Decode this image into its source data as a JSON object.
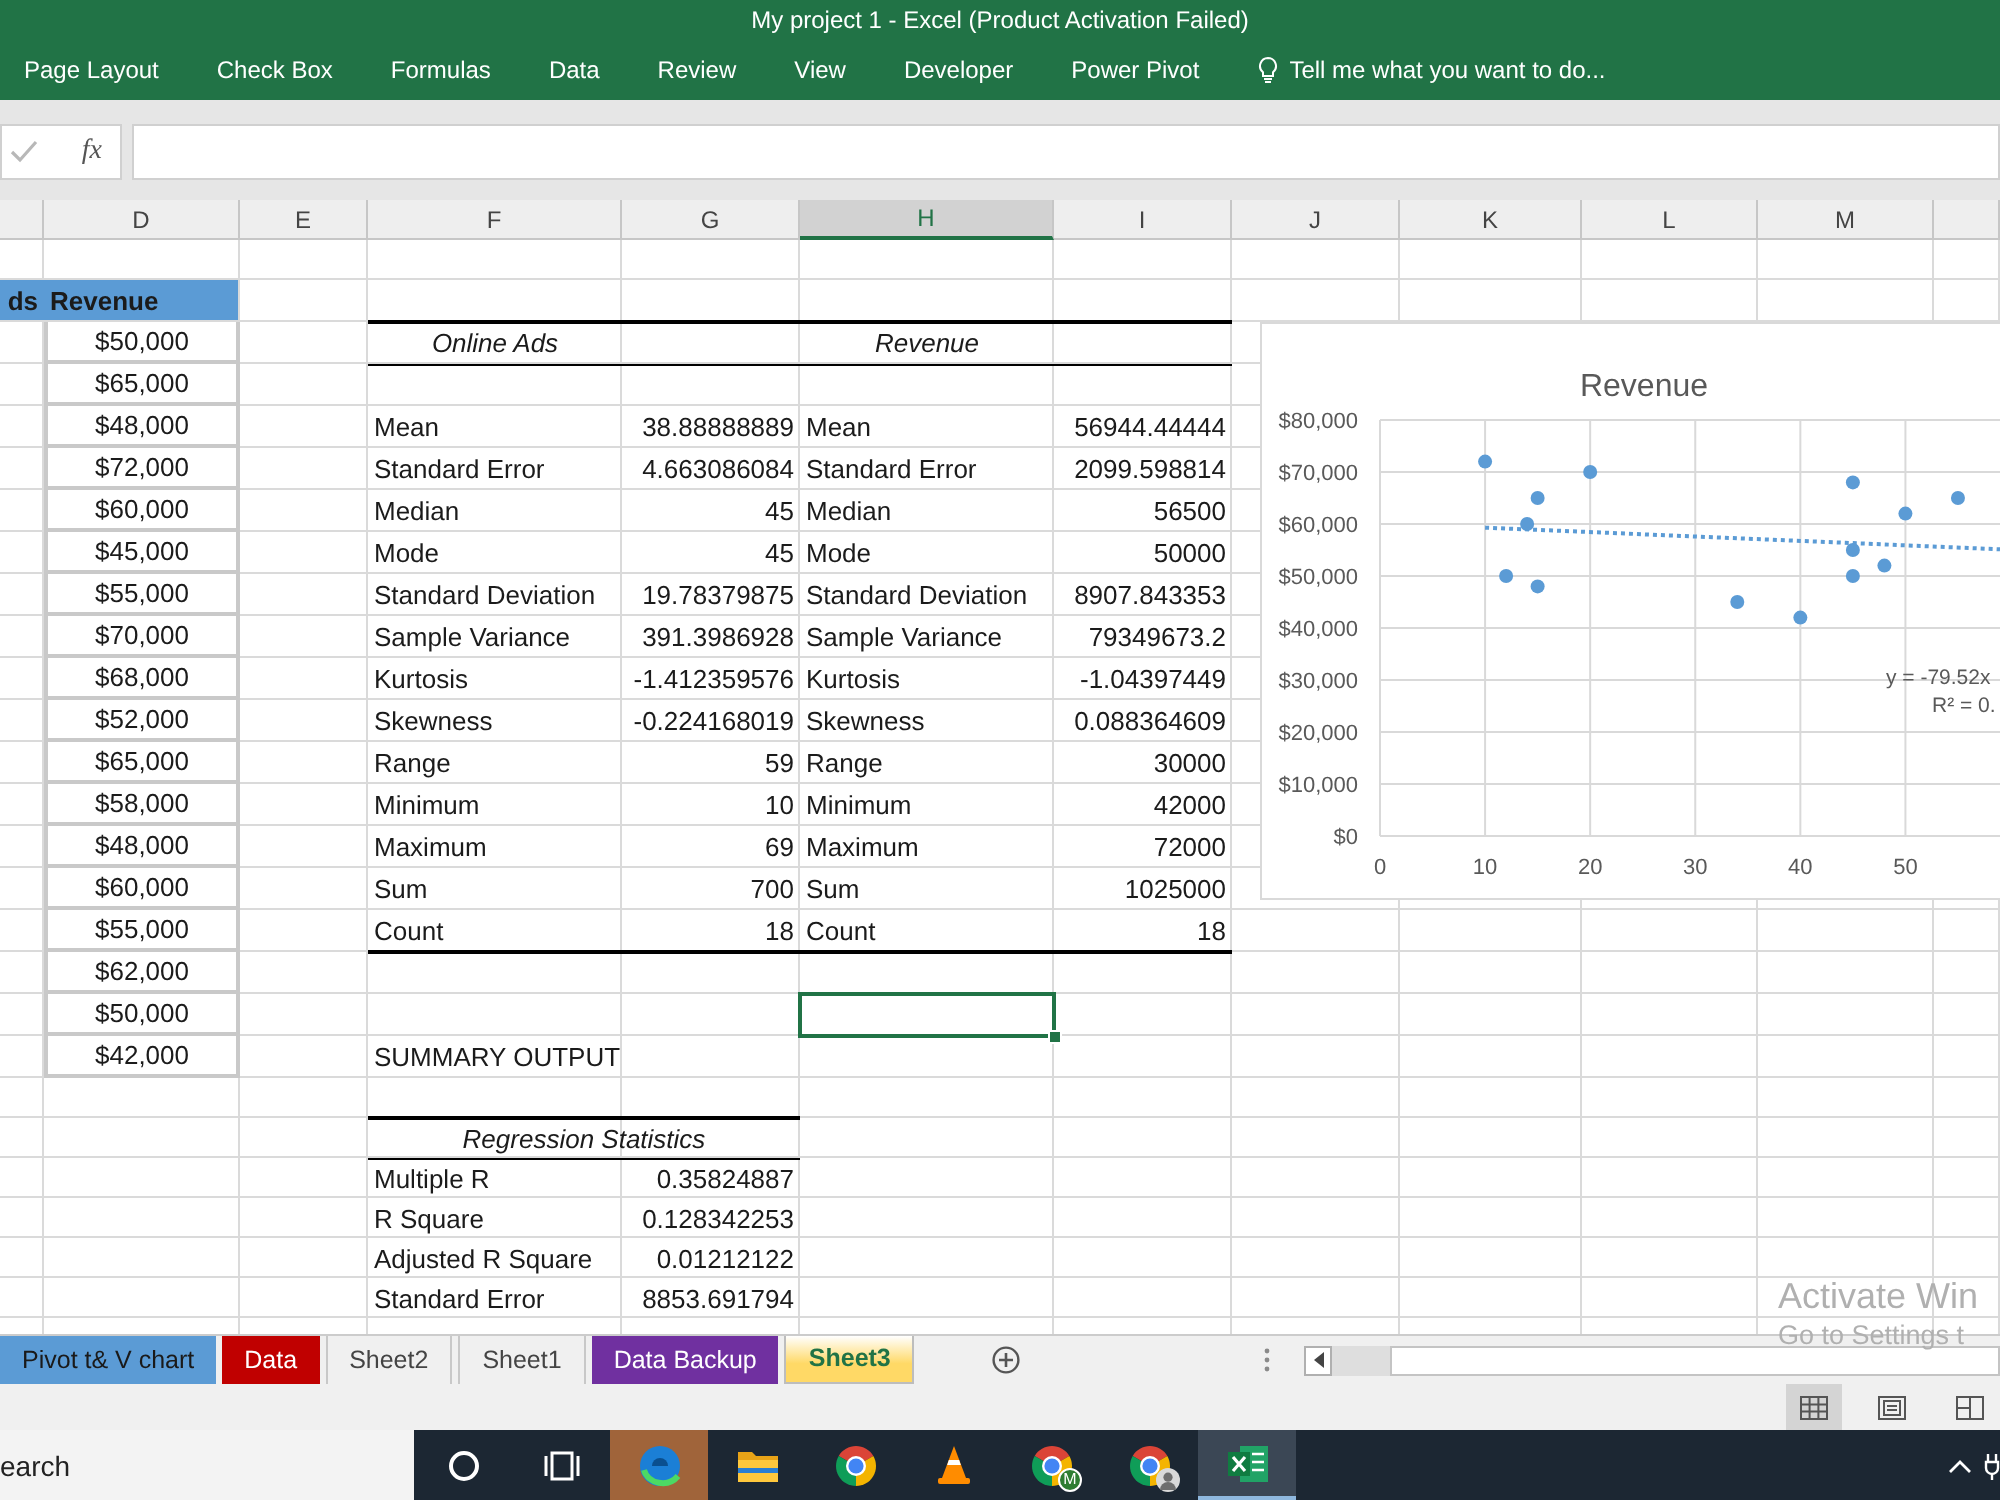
{
  "window": {
    "title": "My project 1 - Excel (Product Activation Failed)"
  },
  "ribbon": {
    "tabs": [
      {
        "label": "Page Layout",
        "selected": false
      },
      {
        "label": "Check Box",
        "selected": false
      },
      {
        "label": "Formulas",
        "selected": false
      },
      {
        "label": "Data",
        "selected": false
      },
      {
        "label": "Review",
        "selected": false
      },
      {
        "label": "View",
        "selected": false
      },
      {
        "label": "Developer",
        "selected": false
      },
      {
        "label": "Power Pivot",
        "selected": false
      }
    ],
    "tell_me": "Tell me what you want to do..."
  },
  "formula_bar": {
    "confirm_disabled": true,
    "function_label": "fx"
  },
  "columns": [
    {
      "label": "D",
      "selected": false
    },
    {
      "label": "E",
      "selected": false
    },
    {
      "label": "F",
      "selected": false
    },
    {
      "label": "G",
      "selected": false
    },
    {
      "label": "H",
      "selected": true
    },
    {
      "label": "I",
      "selected": false
    },
    {
      "label": "J",
      "selected": false
    },
    {
      "label": "K",
      "selected": false
    },
    {
      "label": "L",
      "selected": false
    },
    {
      "label": "M",
      "selected": false
    }
  ],
  "revenue_list": {
    "header_cut": "ds",
    "header": "Revenue",
    "values": [
      "$50,000",
      "$65,000",
      "$48,000",
      "$72,000",
      "$60,000",
      "$45,000",
      "$55,000",
      "$70,000",
      "$68,000",
      "$52,000",
      "$65,000",
      "$58,000",
      "$48,000",
      "$60,000",
      "$55,000",
      "$62,000",
      "$50,000",
      "$42,000"
    ]
  },
  "descriptive_statistics": [
    {
      "title": "Online Ads",
      "rows": [
        {
          "label": "Mean",
          "value": "38.88888889"
        },
        {
          "label": "Standard Error",
          "value": "4.663086084"
        },
        {
          "label": "Median",
          "value": "45"
        },
        {
          "label": "Mode",
          "value": "45"
        },
        {
          "label": "Standard Deviation",
          "value": "19.78379875"
        },
        {
          "label": "Sample Variance",
          "value": "391.3986928"
        },
        {
          "label": "Kurtosis",
          "value": "-1.412359576"
        },
        {
          "label": "Skewness",
          "value": "-0.224168019"
        },
        {
          "label": "Range",
          "value": "59"
        },
        {
          "label": "Minimum",
          "value": "10"
        },
        {
          "label": "Maximum",
          "value": "69"
        },
        {
          "label": "Sum",
          "value": "700"
        },
        {
          "label": "Count",
          "value": "18"
        }
      ]
    },
    {
      "title": "Revenue",
      "rows": [
        {
          "label": "Mean",
          "value": "56944.44444"
        },
        {
          "label": "Standard Error",
          "value": "2099.598814"
        },
        {
          "label": "Median",
          "value": "56500"
        },
        {
          "label": "Mode",
          "value": "50000"
        },
        {
          "label": "Standard Deviation",
          "value": "8907.843353"
        },
        {
          "label": "Sample Variance",
          "value": "79349673.2"
        },
        {
          "label": "Kurtosis",
          "value": "-1.04397449"
        },
        {
          "label": "Skewness",
          "value": "0.088364609"
        },
        {
          "label": "Range",
          "value": "30000"
        },
        {
          "label": "Minimum",
          "value": "42000"
        },
        {
          "label": "Maximum",
          "value": "72000"
        },
        {
          "label": "Sum",
          "value": "1025000"
        },
        {
          "label": "Count",
          "value": "18"
        }
      ]
    }
  ],
  "summary_output": {
    "title": "SUMMARY OUTPUT",
    "regression_statistics": {
      "title": "Regression Statistics",
      "rows": [
        {
          "label": "Multiple R",
          "value": "0.35824887"
        },
        {
          "label": "R Square",
          "value": "0.128342253"
        },
        {
          "label": "Adjusted R Square",
          "value": "0.01212122"
        },
        {
          "label": "Standard Error",
          "value": "8853.691794"
        }
      ]
    }
  },
  "chart": {
    "show_trendline": true,
    "chart_data": {
      "type": "scatter",
      "title": "Revenue",
      "grid": true,
      "x": [
        10,
        12,
        14,
        15,
        15,
        20,
        34,
        40,
        45,
        45,
        45,
        48,
        50,
        55
      ],
      "series": [
        {
          "color": "#5b9bd5",
          "values": [
            72000,
            50000,
            60000,
            65000,
            48000,
            70000,
            45000,
            42000,
            68000,
            55000,
            50000,
            52000,
            62000,
            65000
          ]
        }
      ],
      "xlim": [
        0,
        59
      ],
      "ylim": [
        0,
        80000
      ],
      "xticks": [
        0,
        10,
        20,
        30,
        40,
        50
      ],
      "yticks": [
        {
          "value": 0,
          "label": "$0"
        },
        {
          "value": 10000,
          "label": "$10,000"
        },
        {
          "value": 20000,
          "label": "$20,000"
        },
        {
          "value": 30000,
          "label": "$30,000"
        },
        {
          "value": 40000,
          "label": "$40,000"
        },
        {
          "value": 50000,
          "label": "$50,000"
        },
        {
          "value": 60000,
          "label": "$60,000"
        },
        {
          "value": 70000,
          "label": "$70,000"
        },
        {
          "value": 80000,
          "label": "$80,000"
        }
      ],
      "annotations": [
        {
          "text": "y = -79.52x"
        },
        {
          "text": "R² = 0."
        }
      ]
    }
  },
  "sheet_tabs": [
    {
      "label": "Pivot t& V chart",
      "color": "#5b9bd5",
      "selected": false
    },
    {
      "label": "Data",
      "color": "#c00000",
      "selected": false
    },
    {
      "label": "Sheet2",
      "selected": false
    },
    {
      "label": "Sheet1",
      "selected": false
    },
    {
      "label": "Data Backup",
      "color": "#7030a0",
      "selected": false
    },
    {
      "label": "Sheet3",
      "color": "#ffd966",
      "selected": true
    }
  ],
  "status_bar": {
    "views": [
      {
        "kind": "normal",
        "selected": true
      },
      {
        "kind": "page_layout",
        "selected": false
      },
      {
        "kind": "page_break",
        "selected": false
      }
    ]
  },
  "activation_notice": {
    "title": "Activate Win",
    "text": "Go to Settings t"
  },
  "taskbar": {
    "search": {
      "placeholder": "earch"
    },
    "items": [
      {
        "kind": "cortana",
        "flashing": false,
        "active": false
      },
      {
        "kind": "task_view",
        "flashing": false,
        "active": false
      },
      {
        "kind": "edge",
        "flashing": true,
        "active": false
      },
      {
        "kind": "file_explorer",
        "flashing": false,
        "active": false
      },
      {
        "kind": "chrome",
        "flashing": false,
        "active": false
      },
      {
        "kind": "vlc",
        "flashing": false,
        "active": false
      },
      {
        "kind": "chrome",
        "badge": "M",
        "flashing": false,
        "active": false
      },
      {
        "kind": "chrome_avatar",
        "flashing": false,
        "active": false
      },
      {
        "kind": "excel",
        "flashing": false,
        "active": true
      }
    ]
  }
}
